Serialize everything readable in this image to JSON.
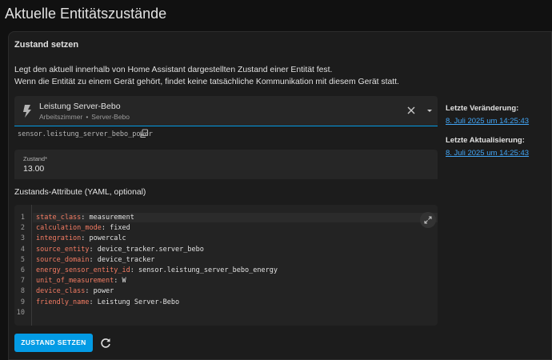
{
  "page": {
    "title": "Aktuelle Entitätszustände"
  },
  "card": {
    "header": "Zustand setzen",
    "description": [
      "Legt den aktuell innerhalb von Home Assistant dargestellten Zustand einer Entität fest.",
      "Wenn die Entität zu einem Gerät gehört, findet keine tatsächliche Kommunikation mit diesem Gerät statt."
    ]
  },
  "entity_picker": {
    "icon": "lightning-bolt-icon",
    "name": "Leistung Server-Bebo",
    "area": "Arbeitszimmer",
    "separator": "•",
    "device": "Server-Bebo",
    "entity_id": "sensor.leistung_server_bebo_power"
  },
  "state_field": {
    "label": "Zustand*",
    "value": "13.00"
  },
  "attributes": {
    "label": "Zustands-Attribute (YAML, optional)",
    "lines": [
      {
        "n": "1",
        "key": "state_class",
        "value": "measurement"
      },
      {
        "n": "2",
        "key": "calculation_mode",
        "value": "fixed"
      },
      {
        "n": "3",
        "key": "integration",
        "value": "powercalc"
      },
      {
        "n": "4",
        "key": "source_entity",
        "value": "device_tracker.server_bebo"
      },
      {
        "n": "5",
        "key": "source_domain",
        "value": "device_tracker"
      },
      {
        "n": "6",
        "key": "energy_sensor_entity_id",
        "value": "sensor.leistung_server_bebo_energy"
      },
      {
        "n": "7",
        "key": "unit_of_measurement",
        "value": "W"
      },
      {
        "n": "8",
        "key": "device_class",
        "value": "power"
      },
      {
        "n": "9",
        "key": "friendly_name",
        "value": "Leistung Server-Bebo"
      },
      {
        "n": "10",
        "key": "",
        "value": ""
      }
    ]
  },
  "actions": {
    "set_state_label": "ZUSTAND SETZEN",
    "refresh_icon": "refresh-icon"
  },
  "side": {
    "last_changed_label": "Letzte Veränderung:",
    "last_changed_value": "8. Juli 2025 um 14:25:43",
    "last_updated_label": "Letzte Aktualisierung:",
    "last_updated_value": "8. Juli 2025 um 14:25:43"
  },
  "colors": {
    "accent": "#039be5",
    "link": "#42a5f5",
    "yaml_key": "#f47c63",
    "background": "#111111",
    "card": "#1c1c1c"
  }
}
